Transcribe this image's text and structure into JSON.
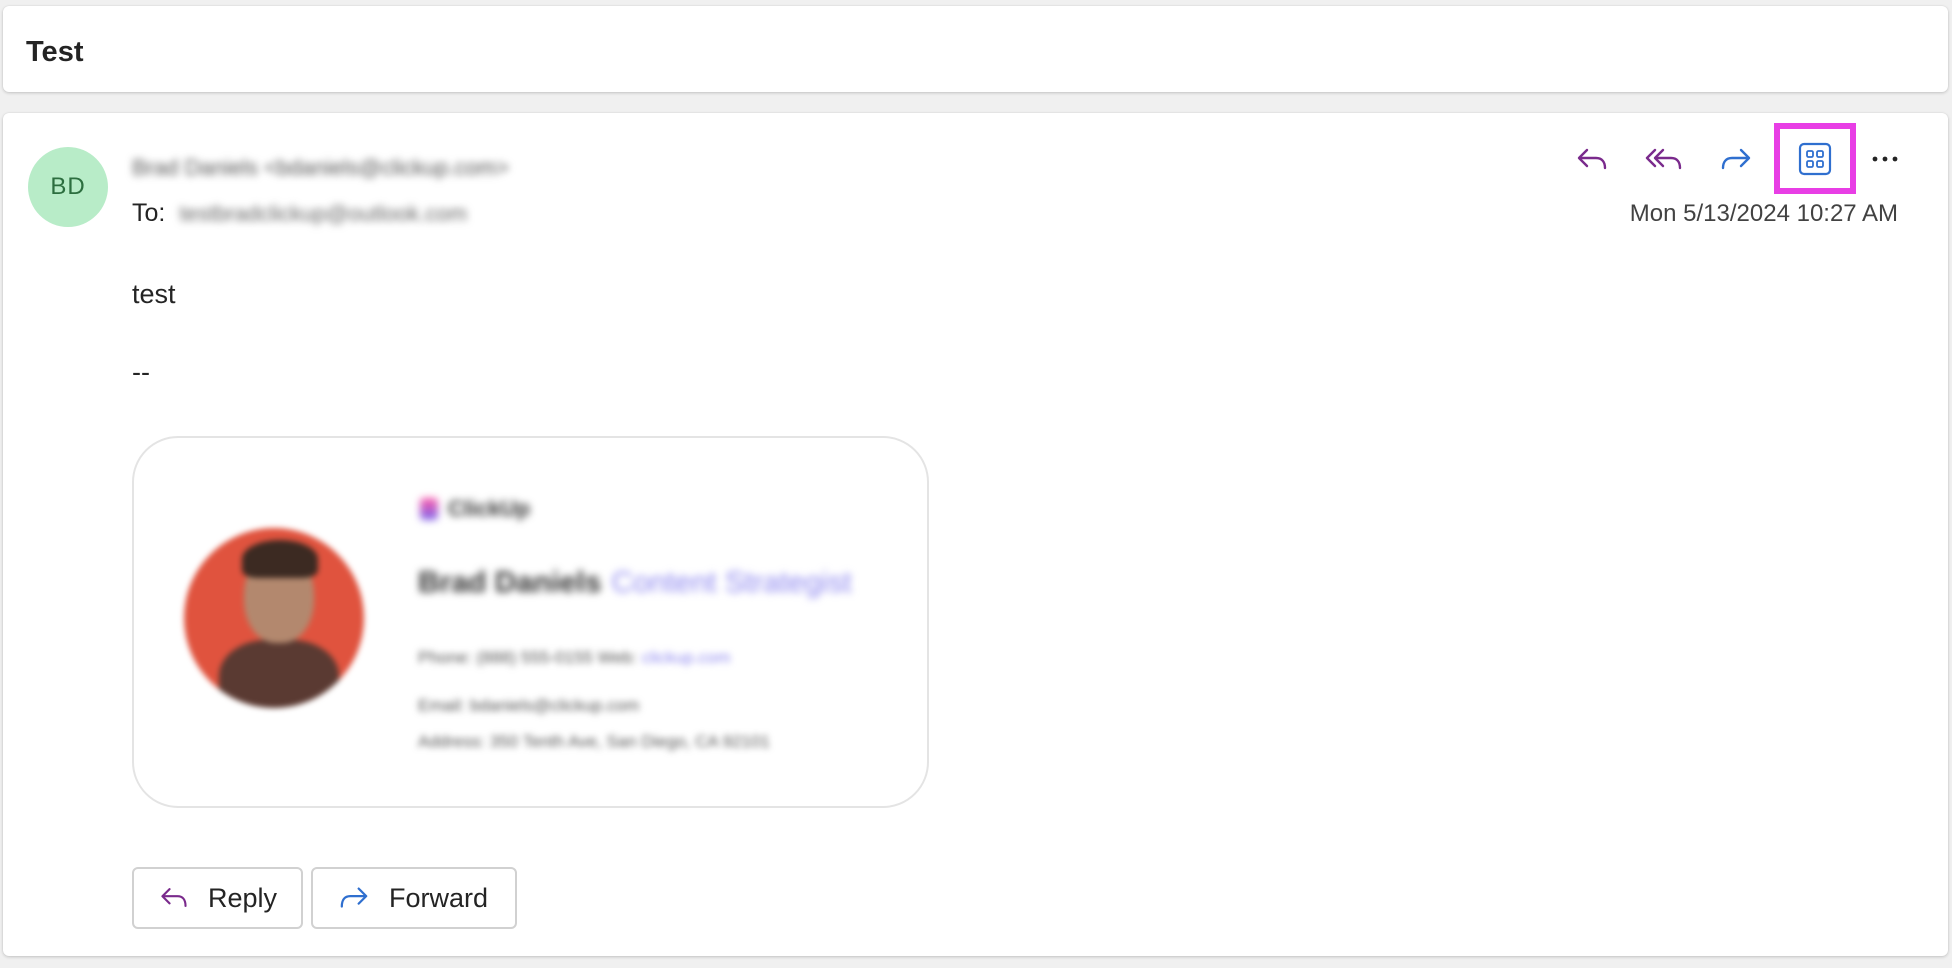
{
  "subject": "Test",
  "sender": {
    "initials": "BD",
    "display": "Brad Daniels <bdaniels@clickup.com>",
    "to_label": "To:",
    "to_value": "testbradclickup@outlook.com"
  },
  "toolbar": {
    "icons": [
      "reply-icon",
      "reply-all-icon",
      "forward-icon",
      "apps-icon",
      "more-icon"
    ],
    "more_label": "···"
  },
  "timestamp": "Mon 5/13/2024 10:27 AM",
  "body": {
    "text": "test",
    "signature_dash": "--"
  },
  "signature": {
    "company": "ClickUp",
    "name": "Brad Daniels",
    "role": "Content Strategist",
    "phone_line": "Phone: (888) 555-0155  Web:",
    "web": "clickup.com",
    "email_line": "Email: bdaniels@clickup.com",
    "address_line": "Address: 350 Tenth Ave, San Diego, CA 92101"
  },
  "buttons": {
    "reply": "Reply",
    "forward": "Forward"
  },
  "colors": {
    "reply_purple": "#7a2a8c",
    "forward_blue": "#2f6fcf",
    "highlight": "#e83ee5",
    "avatar_bg": "#b8ecc8"
  }
}
